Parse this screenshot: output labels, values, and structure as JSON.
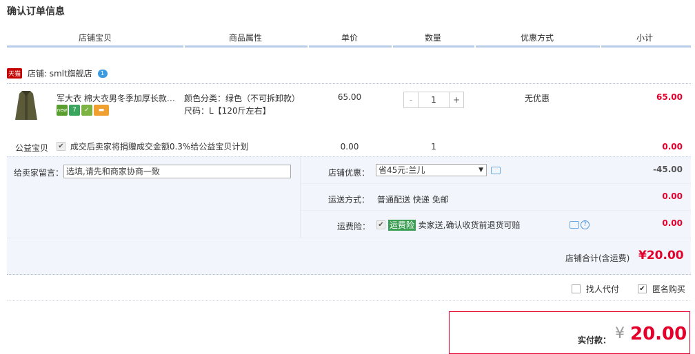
{
  "page_title": "确认订单信息",
  "headers": [
    "店铺宝贝",
    "商品属性",
    "单价",
    "数量",
    "优惠方式",
    "小计"
  ],
  "shop": {
    "badge": "天猫",
    "label": "店铺: smlt旗舰店",
    "chat_badge": "1"
  },
  "item": {
    "name": "军大衣 棉大衣男冬季加厚长款…",
    "attr_color": "颜色分类：绿色（不可拆卸款）",
    "attr_size": "尺码：L【120斤左右】",
    "unit_price": "65.00",
    "quantity": "1",
    "minus": "-",
    "plus": "+",
    "discount": "无优惠",
    "subtotal": "65.00",
    "tags": [
      {
        "name": "new-tag-icon",
        "text": "new",
        "color": "#5a9e2f"
      },
      {
        "name": "seven-day-tag-icon",
        "text": "7",
        "color": "#3aa55c"
      },
      {
        "name": "guarantee-tag-icon",
        "text": "✓",
        "color": "#7cb342"
      },
      {
        "name": "card-tag-icon",
        "text": "▬",
        "color": "#f0a030"
      }
    ]
  },
  "charity": {
    "label": "公益宝贝",
    "text": "成交后卖家将捐赠成交金额0.3%给公益宝贝计划",
    "price": "0.00",
    "qty": "1",
    "subtotal": "0.00"
  },
  "message": {
    "label": "给卖家留言：",
    "value": "选填,请先和商家协商一致"
  },
  "shop_discount": {
    "label": "店铺优惠：",
    "selected": "省45元:兰儿",
    "amount": "-45.00"
  },
  "shipping": {
    "label": "运送方式：",
    "value": "普通配送 快递 免邮",
    "amount": "0.00"
  },
  "insurance": {
    "label": "运费险：",
    "tag": "运费险",
    "text": "卖家送,确认收货前退货可赔",
    "amount": "0.00"
  },
  "shop_total": {
    "label": "店铺合计(含运费)",
    "value": "¥20.00"
  },
  "options": {
    "proxy_pay": "找人代付",
    "anonymous": "匿名购买"
  },
  "final": {
    "label": "实付款：",
    "currency": "¥",
    "value": "20.00"
  },
  "colors": {
    "accent_red": "#e4002b",
    "header_line": "#b7cce8",
    "panel_bg": "#f2f6fc"
  }
}
